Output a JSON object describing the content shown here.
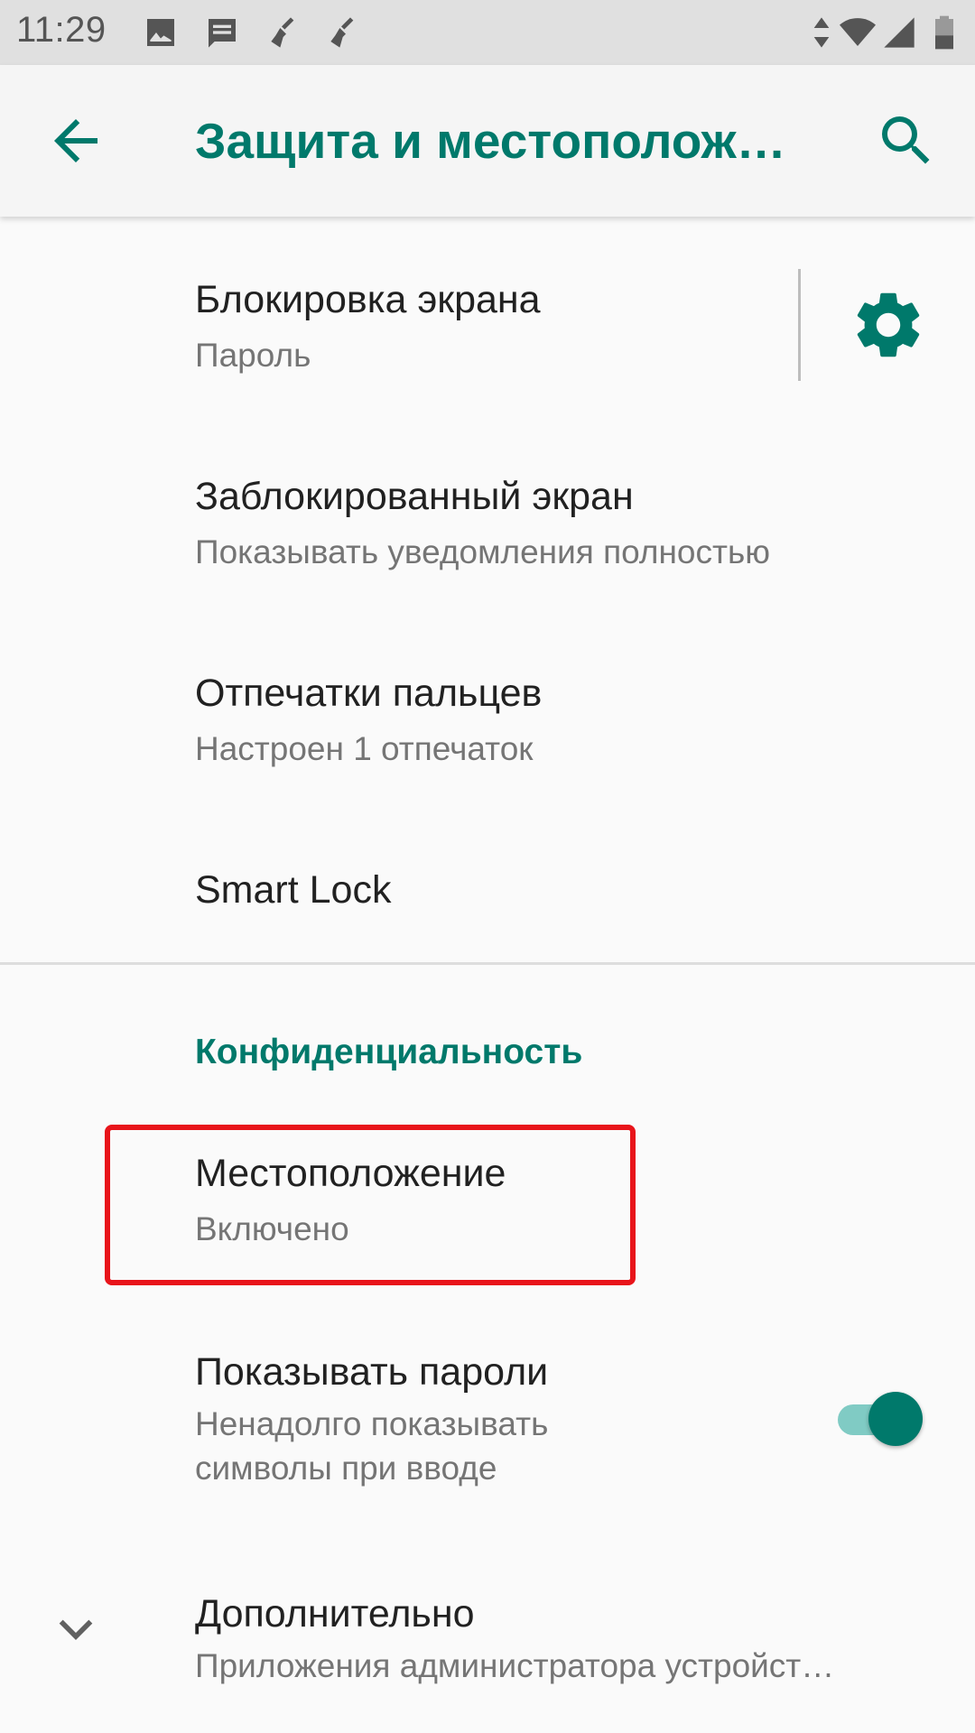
{
  "status_bar": {
    "time": "11:29",
    "left_icons": [
      "image-icon",
      "message-icon",
      "broom-icon",
      "broom-icon"
    ],
    "right_icons": [
      "data-arrows-icon",
      "wifi-icon",
      "signal-icon",
      "battery-icon"
    ]
  },
  "app_bar": {
    "title": "Защита и местополож…",
    "back_icon": "arrow-back-icon",
    "search_icon": "search-icon"
  },
  "items": [
    {
      "title": "Блокировка экрана",
      "summary": "Пароль",
      "trailing": "gear-icon"
    },
    {
      "title": "Заблокированный экран",
      "summary": "Показывать уведомления полностью"
    },
    {
      "title": "Отпечатки пальцев",
      "summary": "Настроен 1 отпечаток"
    },
    {
      "title": "Smart Lock"
    }
  ],
  "privacy": {
    "header": "Конфиденциальность",
    "items": [
      {
        "title": "Местоположение",
        "summary": "Включено",
        "highlighted": true
      },
      {
        "title": "Показывать пароли",
        "summary_line1": "Ненадолго показывать",
        "summary_line2": "символы при вводе",
        "toggle_on": true
      },
      {
        "title": "Дополнительно",
        "summary": "Приложения администратора устройст…",
        "leading": "chevron-down-icon"
      }
    ]
  },
  "colors": {
    "accent": "#00796b",
    "highlight": "#e8141a",
    "status_bar_bg": "#e0e0e0"
  }
}
